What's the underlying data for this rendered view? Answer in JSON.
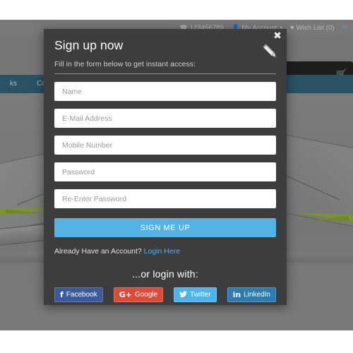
{
  "topbar": {
    "phone": "123456789",
    "phone_icon": "phone-icon",
    "account_label": "My Account",
    "account_icon": "user-icon",
    "wishlist_label": "Wish List (0)",
    "wishlist_icon": "heart-icon",
    "cart_icon": "cart-icon",
    "caret": "▾"
  },
  "nav": {
    "items": [
      {
        "label": "ks"
      },
      {
        "label": "Compon"
      }
    ]
  },
  "modal": {
    "title": "Sign up now",
    "subtitle": "Fill in the form below to get instant access:",
    "close_label": "✖",
    "close_icon": "close-icon",
    "pencil_icon": "pencil-icon",
    "fields": [
      {
        "name": "name",
        "placeholder": "Name",
        "value": "",
        "type": "text"
      },
      {
        "name": "email",
        "placeholder": "E-Mail Address",
        "value": "",
        "type": "text"
      },
      {
        "name": "mobile",
        "placeholder": "Mobile Number",
        "value": "",
        "type": "text"
      },
      {
        "name": "password",
        "placeholder": "Password",
        "value": "",
        "type": "password"
      },
      {
        "name": "confirm-password",
        "placeholder": "Re-Enter Password",
        "value": "",
        "type": "password"
      }
    ],
    "submit_label": "SIGN ME UP",
    "account_prompt": "Already Have an Account?",
    "account_link": "Login Here",
    "or_login_label": "...or login with:",
    "socials": [
      {
        "label": "Facebook",
        "icon": "facebook-icon",
        "glyph": "f",
        "color": "#3b5a9a"
      },
      {
        "label": "Google",
        "icon": "google-plus-icon",
        "glyph": "G+",
        "color": "#dc4a38"
      },
      {
        "label": "Twitter",
        "icon": "twitter-icon",
        "glyph": "⚑",
        "color": "#4cb4e8"
      },
      {
        "label": "LinkedIn",
        "icon": "linkedin-icon",
        "glyph": "in",
        "color": "#2d7bb0"
      }
    ]
  },
  "colors": {
    "accent": "#52b3e4",
    "modal_bg": "#3d3d3d",
    "nav_bg": "#2a5c73",
    "page_bg": "#878787"
  }
}
